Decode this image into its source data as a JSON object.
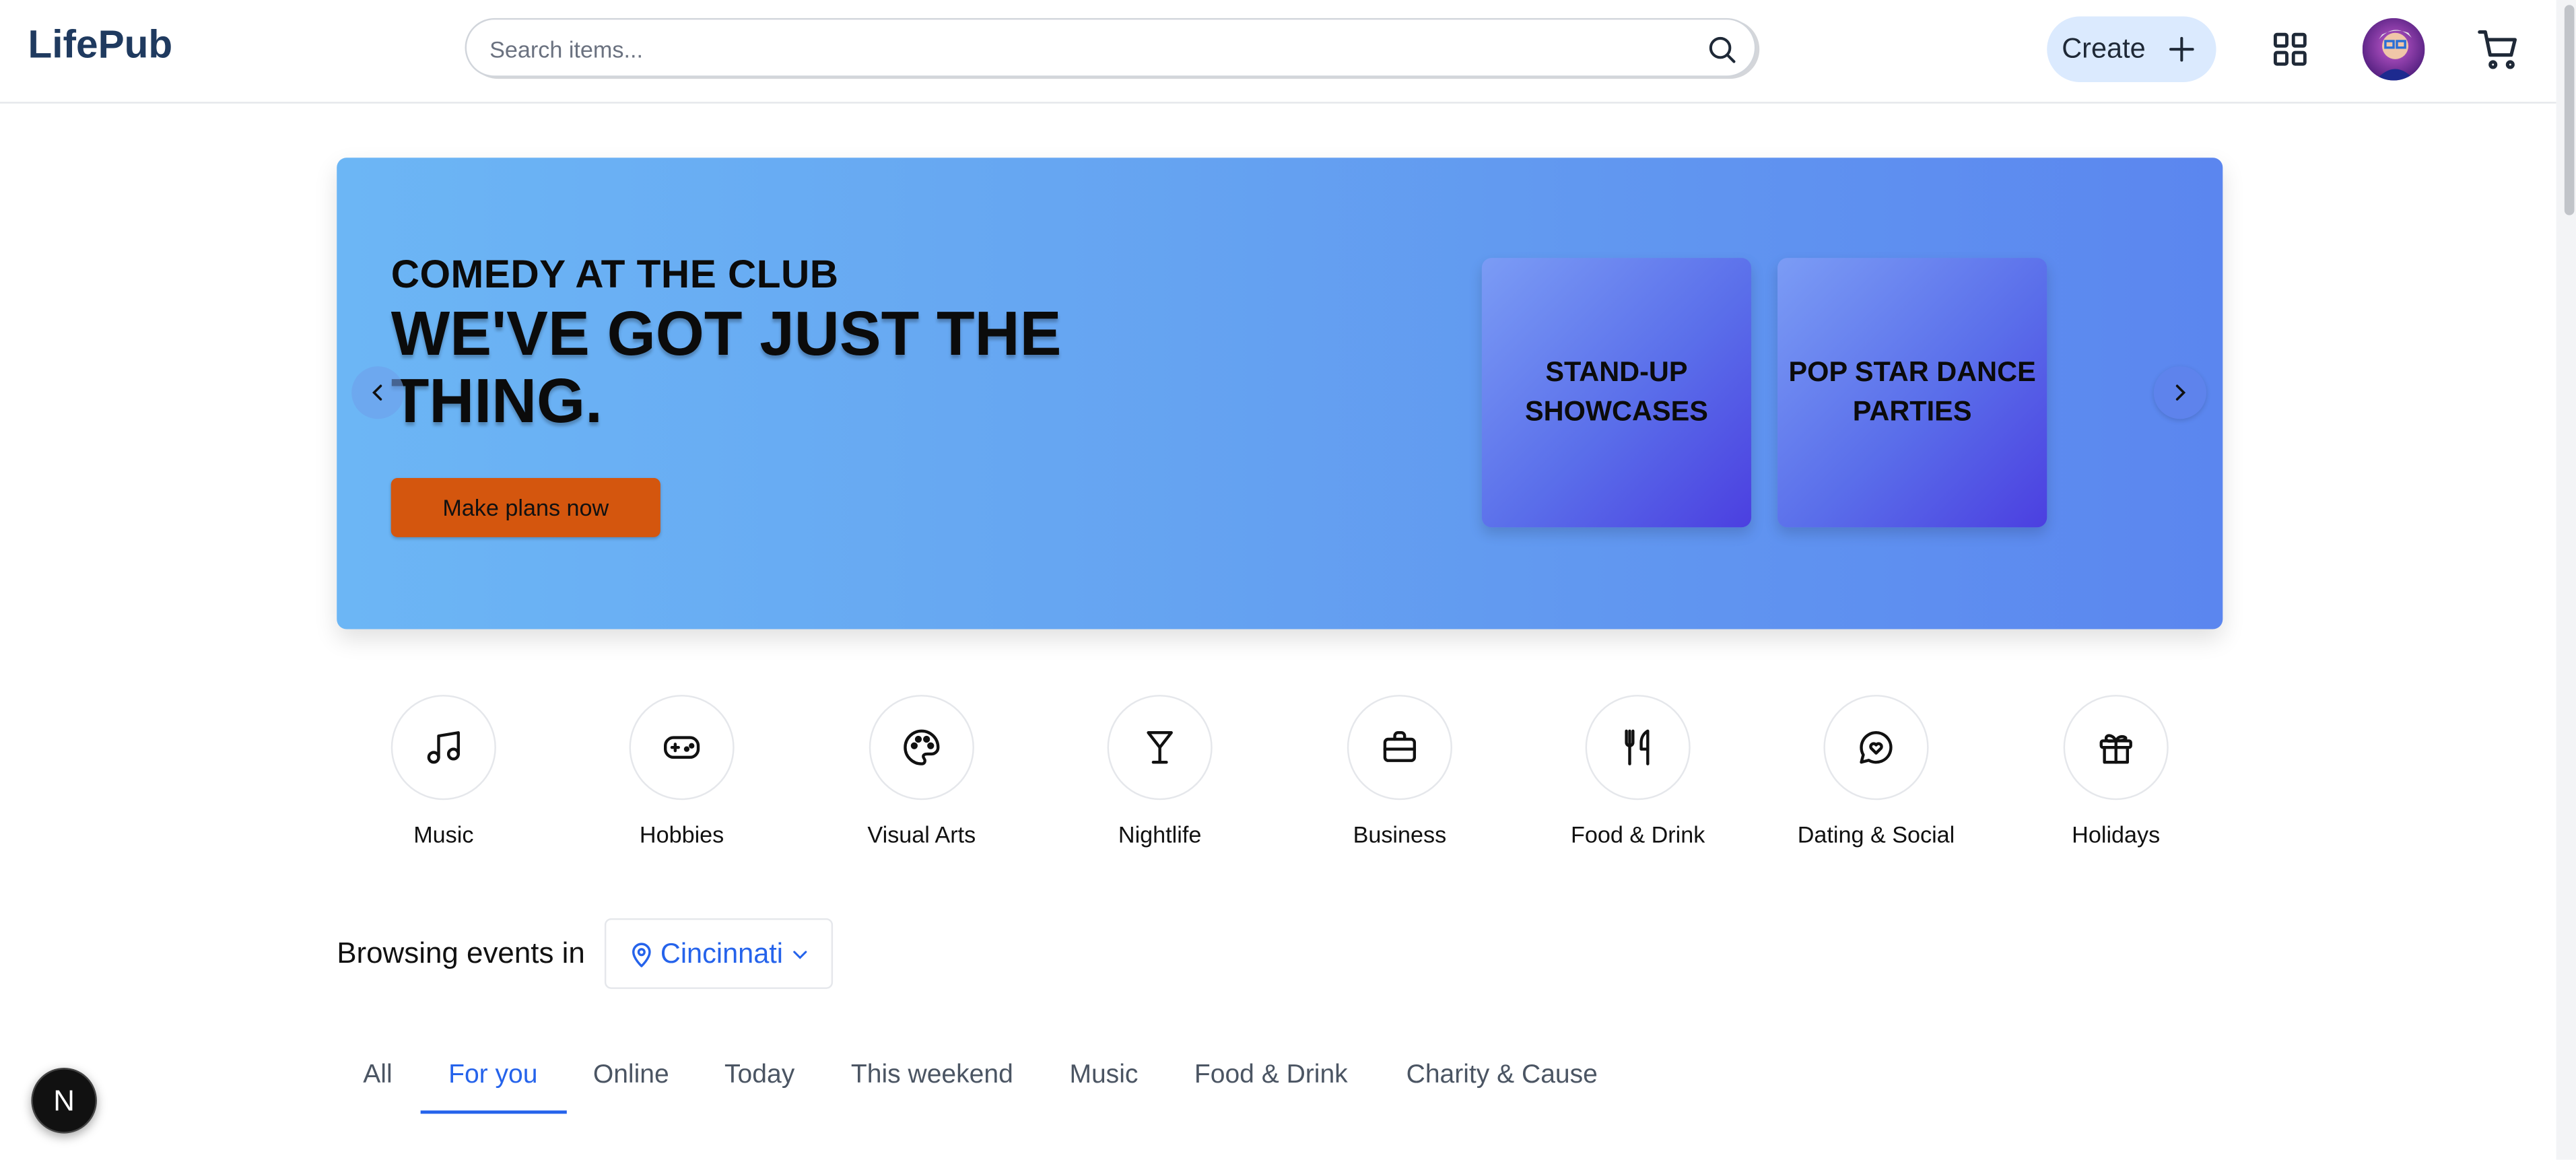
{
  "header": {
    "logo": "LifePub",
    "search_placeholder": "Search items...",
    "create_label": "Create"
  },
  "hero": {
    "kicker": "COMEDY AT THE CLUB",
    "title": "WE'VE GOT JUST THE THING.",
    "cta": "Make plans now",
    "cards": [
      "STAND-UP SHOWCASES",
      "POP STAR DANCE PARTIES"
    ]
  },
  "categories": [
    {
      "label": "Music",
      "icon": "music-note-icon"
    },
    {
      "label": "Hobbies",
      "icon": "gamepad-icon"
    },
    {
      "label": "Visual Arts",
      "icon": "palette-icon"
    },
    {
      "label": "Nightlife",
      "icon": "cocktail-icon"
    },
    {
      "label": "Business",
      "icon": "briefcase-icon"
    },
    {
      "label": "Food & Drink",
      "icon": "utensils-icon"
    },
    {
      "label": "Dating & Social",
      "icon": "chat-heart-icon"
    },
    {
      "label": "Holidays",
      "icon": "gift-icon"
    }
  ],
  "browse": {
    "label": "Browsing events in",
    "location": "Cincinnati"
  },
  "tabs": [
    {
      "label": "All",
      "active": false
    },
    {
      "label": "For you",
      "active": true
    },
    {
      "label": "Online",
      "active": false
    },
    {
      "label": "Today",
      "active": false
    },
    {
      "label": "This weekend",
      "active": false
    },
    {
      "label": "Music",
      "active": false
    },
    {
      "label": "Food & Drink",
      "active": false
    },
    {
      "label": "Charity & Cause",
      "active": false
    }
  ],
  "badge": "N",
  "colors": {
    "accent": "#2563eb",
    "cta": "#d4560e",
    "logo": "#1f3a5f",
    "create_bg": "#dbeafe"
  }
}
